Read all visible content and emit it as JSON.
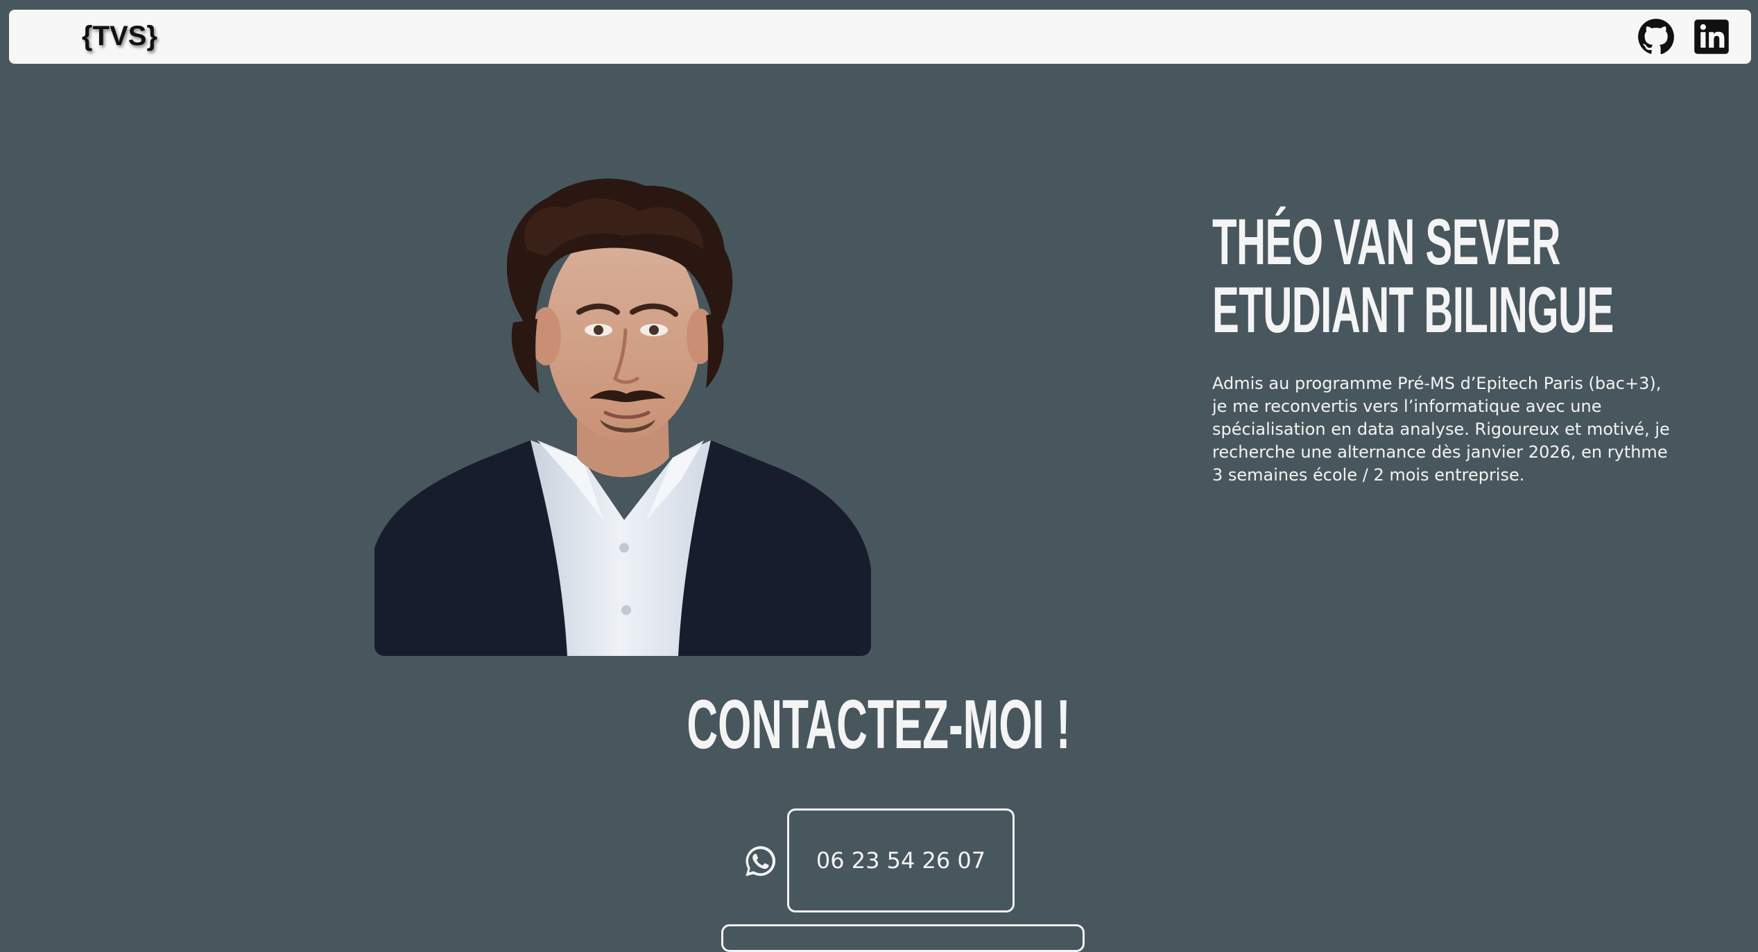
{
  "header": {
    "logo_text": "{TVS}",
    "github_icon": "github-icon",
    "linkedin_icon": "linkedin-icon"
  },
  "hero": {
    "title_line1": "Théo Van Sever",
    "title_line2": "Etudiant bilingue",
    "description": "Admis au programme Pré-MS d’Epitech Paris (bac+3), je me reconvertis vers l’informatique avec une spécialisation en data analyse. Rigoureux et motivé, je recherche une alternance dès janvier 2026, en rythme 3 semaines école / 2 mois entreprise."
  },
  "contact": {
    "title": "Contactez-moi !",
    "whatsapp_icon": "whatsapp-icon",
    "phone": "06 23 54 26 07"
  },
  "colors": {
    "background": "#48575d",
    "navbar": "#f7f7f7",
    "text_light": "#f3f3f3",
    "sweater": "#171d2c",
    "shirt": "#dfe5ee"
  }
}
